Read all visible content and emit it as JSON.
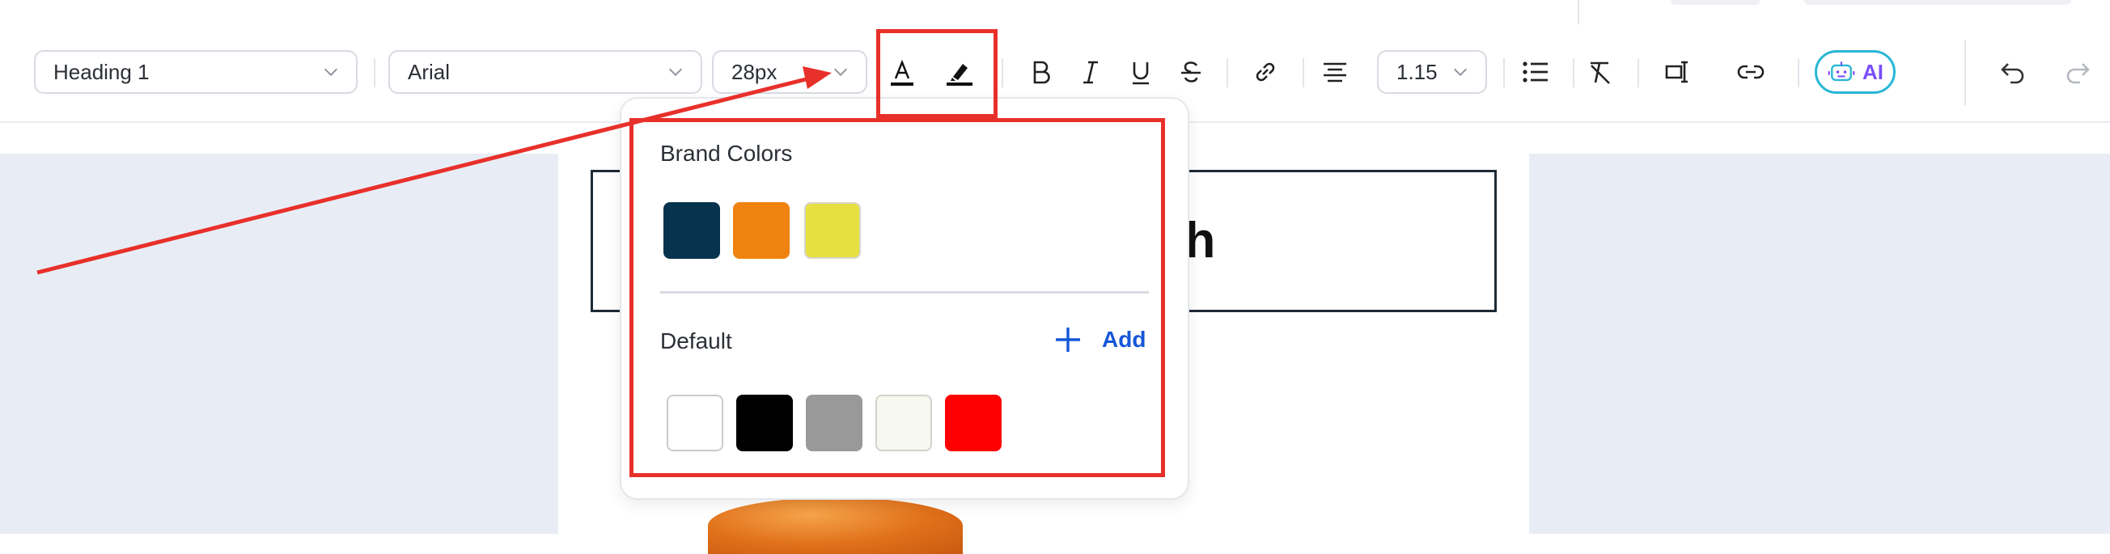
{
  "toolbar": {
    "block_style": "Heading 1",
    "font_family": "Arial",
    "font_size": "28px",
    "line_spacing": "1.15",
    "ai_label": "AI"
  },
  "document": {
    "heading_fragment": "ch"
  },
  "color_popover": {
    "brand_title": "Brand Colors",
    "brand_colors": [
      "#06344f",
      "#f0820f",
      "#e8e040"
    ],
    "default_title": "Default",
    "add_label": "Add",
    "default_colors": [
      "#ffffff",
      "#000000",
      "#999999",
      "#f7f8ef",
      "#fe0000"
    ]
  },
  "colors": {
    "annotation": "#e8302a",
    "accent": "#1557d8",
    "ai_border": "#28b7d6",
    "ai_text": "#7b4dff"
  }
}
